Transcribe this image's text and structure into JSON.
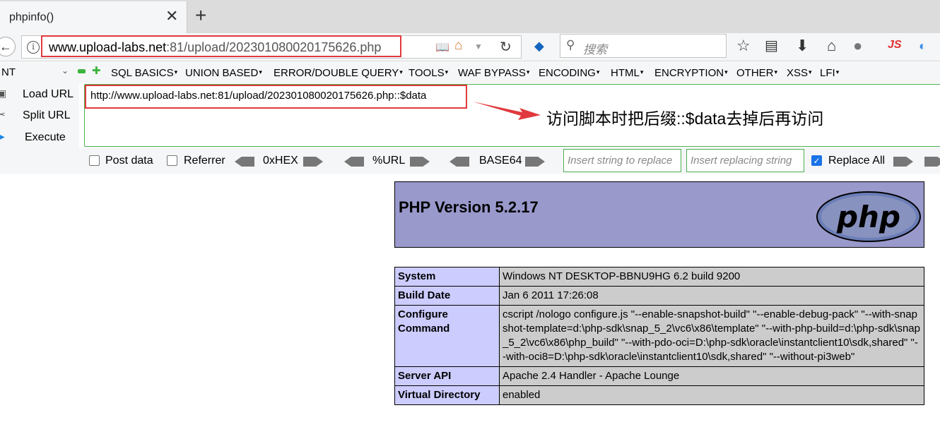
{
  "tab": {
    "title": "phpinfo()",
    "close": "✕",
    "new_tab": "+"
  },
  "navbar": {
    "back": "←",
    "info": "i",
    "url_host": "www.upload-labs.net",
    "url_path": ":81/upload/202301080020175626.php",
    "search_placeholder": "搜索",
    "js_label": "JS"
  },
  "hackbar": {
    "select_value": "NT",
    "menu": [
      "SQL BASICS",
      "UNION BASED",
      "ERROR/DOUBLE QUERY",
      "TOOLS",
      "WAF BYPASS",
      "ENCODING",
      "HTML",
      "ENCRYPTION",
      "OTHER",
      "XSS",
      "LFI"
    ],
    "load_url": "Load URL",
    "split_url": "Split URL",
    "execute": "Execute",
    "url_value": "http://www.upload-labs.net:81/upload/202301080020175626.php::$data",
    "post_data": "Post data",
    "referrer": "Referrer",
    "hex": "0xHEX",
    "url_enc": "%URL",
    "base64": "BASE64",
    "replace_placeholder": "Insert string to replace",
    "replacing_placeholder": "Insert replacing string",
    "replace_all": "Replace All"
  },
  "annotation": "访问脚本时把后缀::$data去掉后再访问",
  "page": {
    "version_title": "PHP Version 5.2.17",
    "logo_text": "php",
    "rows": [
      {
        "key": "System",
        "value": "Windows NT DESKTOP-BBNU9HG 6.2 build 9200"
      },
      {
        "key": "Build Date",
        "value": "Jan 6 2011 17:26:08"
      },
      {
        "key": "Configure Command",
        "value": "cscript /nologo configure.js \"--enable-snapshot-build\" \"--enable-debug-pack\" \"--with-snapshot-template=d:\\php-sdk\\snap_5_2\\vc6\\x86\\template\" \"--with-php-build=d:\\php-sdk\\snap_5_2\\vc6\\x86\\php_build\" \"--with-pdo-oci=D:\\php-sdk\\oracle\\instantclient10\\sdk,shared\" \"--with-oci8=D:\\php-sdk\\oracle\\instantclient10\\sdk,shared\" \"--without-pi3web\""
      },
      {
        "key": "Server API",
        "value": "Apache 2.4 Handler - Apache Lounge"
      },
      {
        "key": "Virtual Directory",
        "value": "enabled"
      }
    ]
  },
  "colors": {
    "highlight_red": "#e0393e",
    "php_header": "#9999cc",
    "key_cell": "#ccccff",
    "value_cell": "#cccccc",
    "hackbar_green": "#4caf50"
  }
}
